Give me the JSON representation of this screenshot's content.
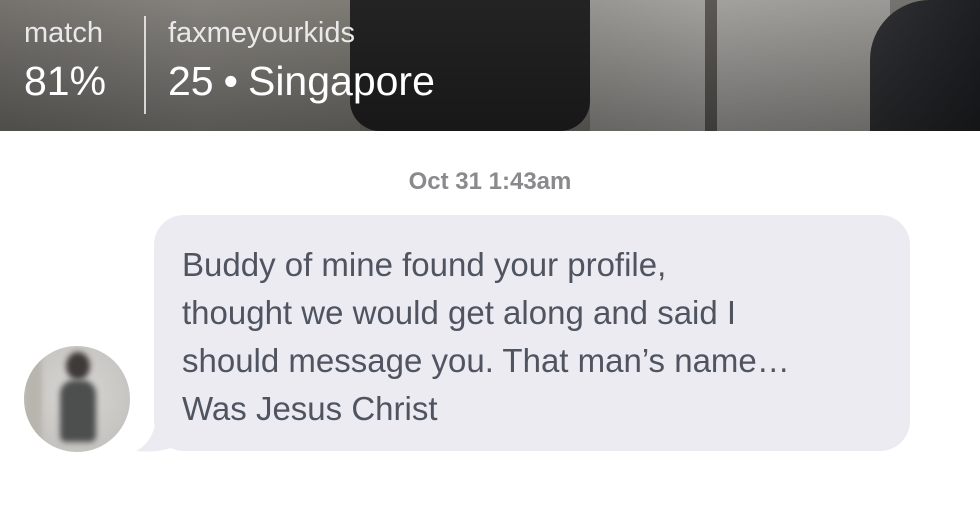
{
  "header": {
    "match_label": "match",
    "match_value": "81%",
    "username": "faxmeyourkids",
    "age": "25",
    "separator": "•",
    "location": "Singapore"
  },
  "conversation": {
    "timestamp": "Oct 31 1:43am",
    "messages": [
      {
        "sender": "them",
        "avatar": "profile-photo-avatar",
        "text": "Buddy of mine found your profile,\nthought we would get along and said I\nshould message you. That man’s name…\nWas Jesus Christ"
      }
    ]
  },
  "colors": {
    "bubble_background": "#ebebf1",
    "message_text": "#4f5460",
    "timestamp_text": "#8a8a8d",
    "header_text": "#ffffff"
  }
}
